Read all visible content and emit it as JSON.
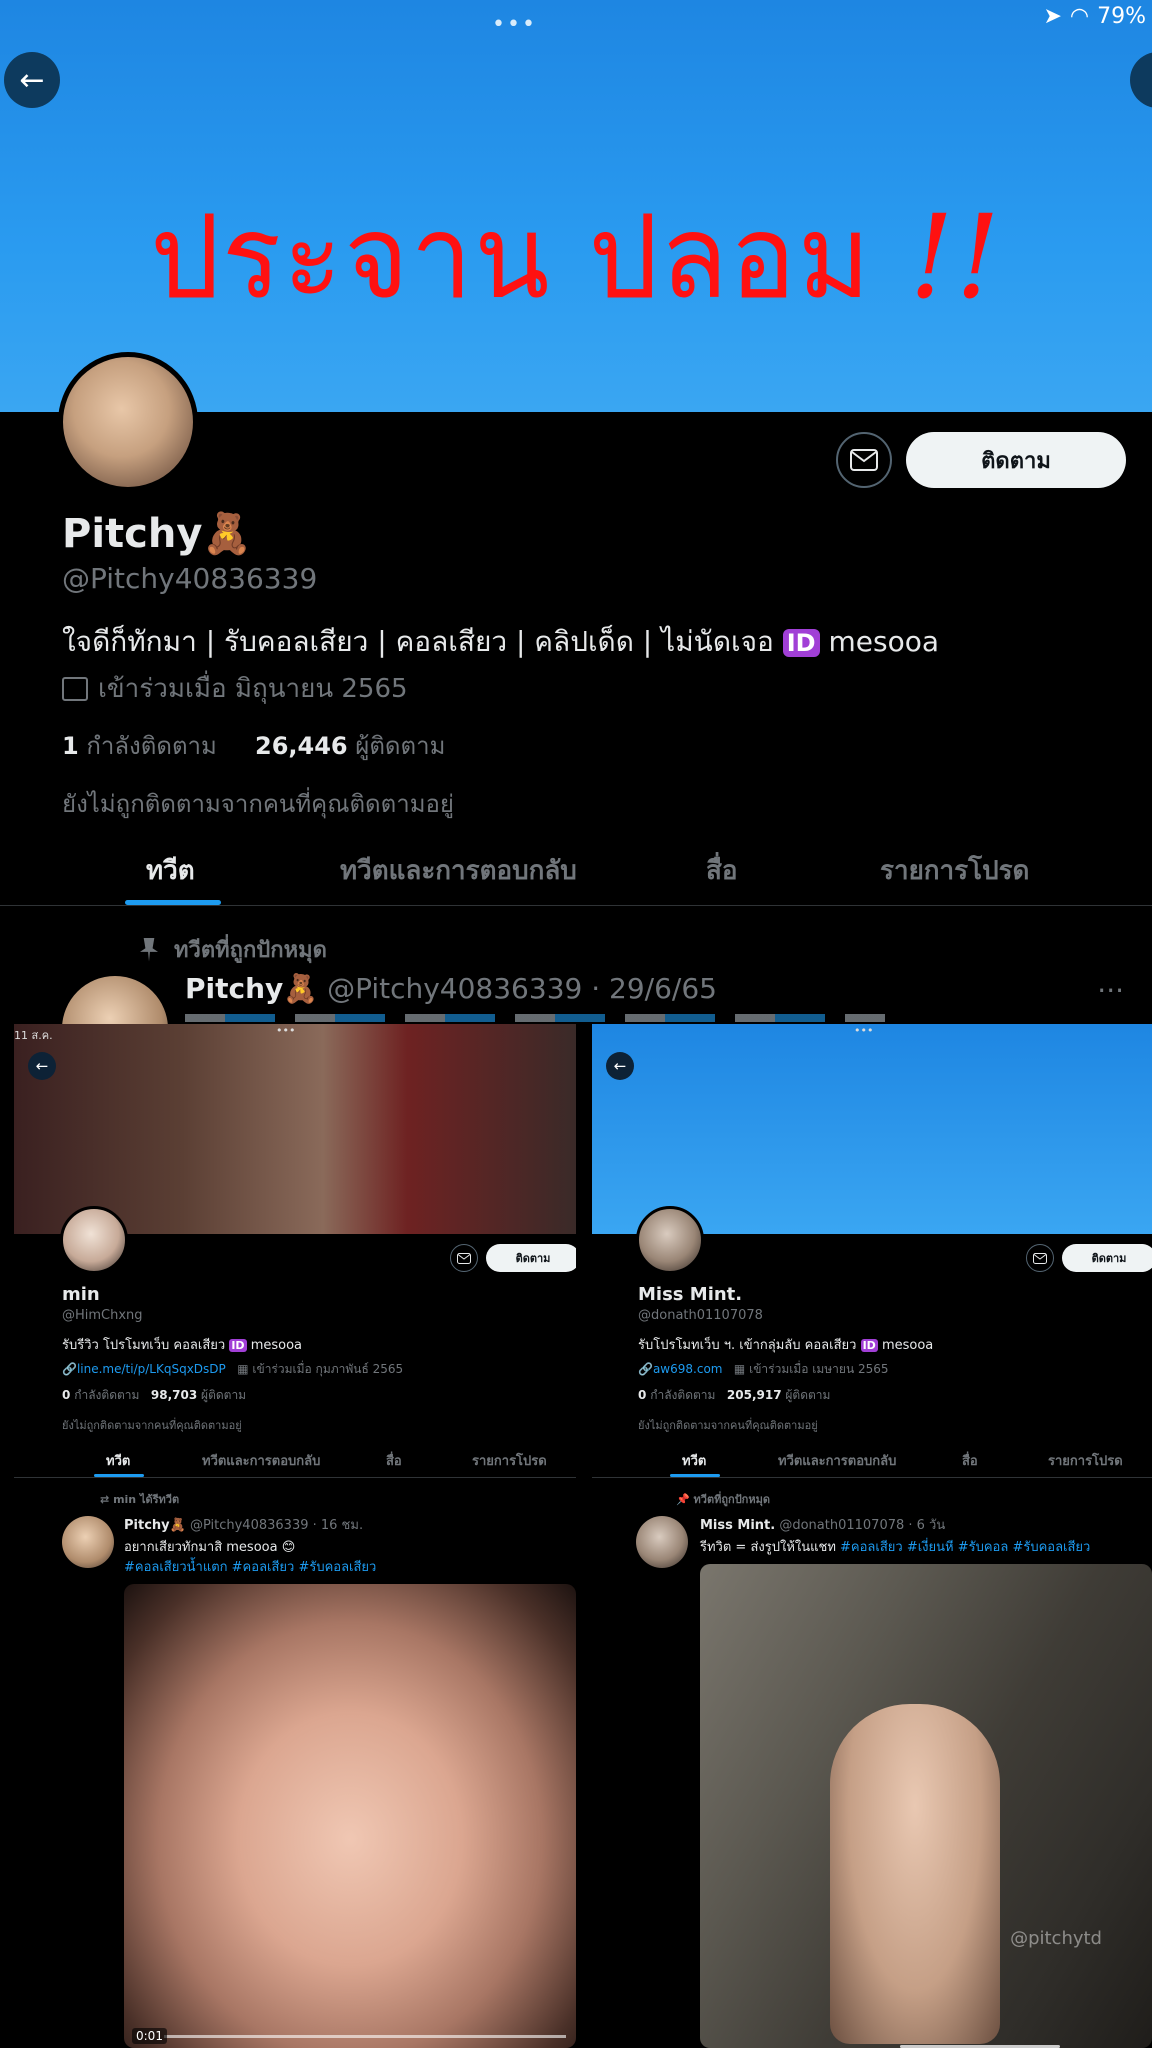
{
  "top": {
    "status": {
      "dots": "•••",
      "battery": "79%"
    },
    "overlay_text": "ประจาน ปลอม",
    "overlay_bang": "!!",
    "follow_label": "ติดตาม",
    "display_name": "Pitchy🧸",
    "handle": "@Pitchy40836339",
    "bio_text": "ใจดีก็ทักมา | รับคอลเสียว | คอลเสียว | คลิปเด็ด | ไม่นัดเจอ",
    "bio_id_badge": "ID",
    "bio_id": "mesooa",
    "joined": "เข้าร่วมเมื่อ มิถุนายน 2565",
    "following_count": "1",
    "following_label": "กำลังติดตาม",
    "followers_count": "26,446",
    "followers_label": "ผู้ติดตาม",
    "not_followed": "ยังไม่ถูกติดตามจากคนที่คุณติดตามอยู่",
    "tabs": [
      "ทวีต",
      "ทวีตและการตอบกลับ",
      "สื่อ",
      "รายการโปรด"
    ],
    "pinned_label": "ทวีตที่ถูกปักหมุด",
    "tweet_name": "Pitchy🧸",
    "tweet_handle_date": "@Pitchy40836339 · 29/6/65",
    "more": "···"
  },
  "left": {
    "status_time": "11 ส.ค.",
    "status_dots": "•••",
    "follow_label": "ติดตาม",
    "display_name": "min",
    "handle": "@HimChxng",
    "bio_text": "รับรีวิว โปรโมทเว็บ คอลเสียว",
    "bio_id_badge": "ID",
    "bio_id": "mesooa",
    "link": "line.me/ti/p/LKqSqxDsDP",
    "joined": "เข้าร่วมเมื่อ กุมภาพันธ์ 2565",
    "following_count": "0",
    "following_label": "กำลังติดตาม",
    "followers_count": "98,703",
    "followers_label": "ผู้ติดตาม",
    "not_followed": "ยังไม่ถูกติดตามจากคนที่คุณติดตามอยู่",
    "tabs": [
      "ทวีต",
      "ทวีตและการตอบกลับ",
      "สื่อ",
      "รายการโปรด"
    ],
    "retweet_label": "min ได้รีทวีต",
    "tweet_name": "Pitchy🧸",
    "tweet_handle_date": "@Pitchy40836339 · 16 ชม.",
    "tweet_text": "อยากเสียวทักมาสิ mesooa 😊",
    "tweet_tags": "#คอลเสียวน้ำแตก #คอลเสียว #รับคอลเสียว",
    "video_time": "0:01"
  },
  "right": {
    "status_dots": "•••",
    "follow_label": "ติดตาม",
    "display_name": "Miss Mint.",
    "handle": "@donath01107078",
    "bio_text": "รับโปรโมทเว็บ ฯ. เข้ากลุ่มลับ คอลเสียว",
    "bio_id_badge": "ID",
    "bio_id": "mesooa",
    "link": "aw698.com",
    "joined": "เข้าร่วมเมื่อ เมษายน 2565",
    "following_count": "0",
    "following_label": "กำลังติดตาม",
    "followers_count": "205,917",
    "followers_label": "ผู้ติดตาม",
    "not_followed": "ยังไม่ถูกติดตามจากคนที่คุณติดตามอยู่",
    "tabs": [
      "ทวีต",
      "ทวีตและการตอบกลับ",
      "สื่อ",
      "รายการโปรด"
    ],
    "pinned_label": "ทวีตที่ถูกปักหมุด",
    "tweet_name": "Miss Mint.",
    "tweet_handle_date": "@donath01107078 · 6 วัน",
    "tweet_text": "รีทวิต = ส่งรูปให้ในแชท",
    "tweet_tags": "#คอลเสียว #เงี่ยนหี #รับคอล #รับคอลเสียว",
    "watermark": "@pitchytd"
  }
}
